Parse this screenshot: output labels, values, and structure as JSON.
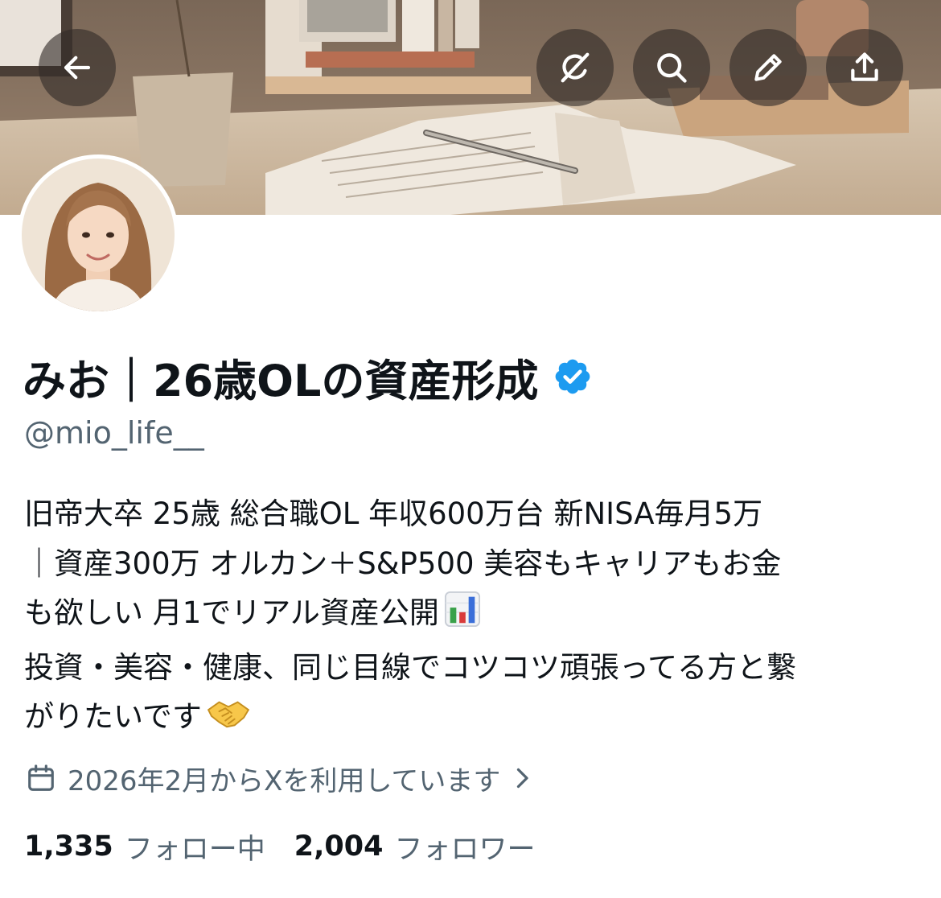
{
  "header": {
    "icons": {
      "back": "back-arrow-icon",
      "grok": "grok-icon",
      "search": "search-icon",
      "edit": "pencil-icon",
      "share": "share-icon"
    }
  },
  "profile": {
    "display_name": "みお｜26歳OLの資産形成",
    "verified": true,
    "handle": "@mio_life__",
    "bio_lines": [
      "旧帝大卒 25歳 総合職OL 年収600万台 新NISA毎月5万",
      "｜資産300万 オルカン＋S&P500 美容もキャリアもお金",
      "も欲しい 月1でリアル資産公開",
      "投資・美容・健康、同じ目線でコツコツ頑張ってる方と繋",
      "がりたいです"
    ],
    "joined": "2026年2月からXを利用しています",
    "following_count": "1,335",
    "following_label": "フォロー中",
    "followers_count": "2,004",
    "followers_label": "フォロワー"
  },
  "colors": {
    "text_primary": "#0f1419",
    "text_secondary": "#536471",
    "verified_blue": "#1d9bf0",
    "header_button_bg": "#322c28"
  }
}
